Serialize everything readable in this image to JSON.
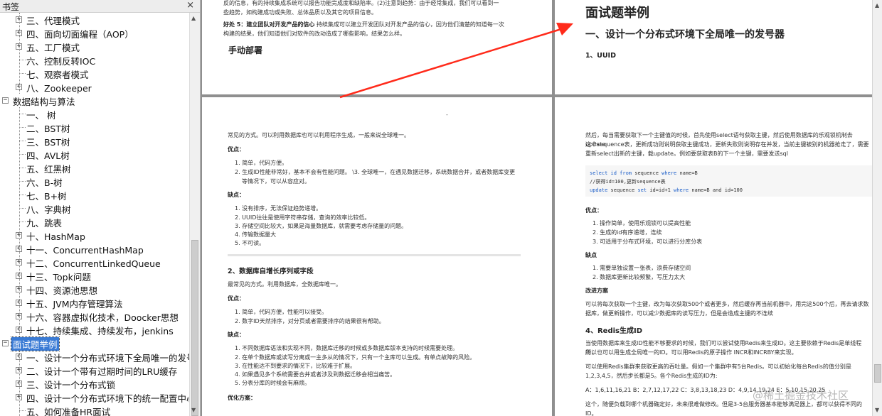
{
  "sidebar": {
    "title": "书签",
    "close": "×",
    "items": [
      {
        "level": 1,
        "expander": "+",
        "label": "三、代理模式"
      },
      {
        "level": 1,
        "expander": "+",
        "label": "四、面向切面编程（AOP）"
      },
      {
        "level": 1,
        "expander": "+",
        "label": "五、工厂模式"
      },
      {
        "level": 1,
        "expander": "",
        "label": "六、控制反转IOC"
      },
      {
        "level": 1,
        "expander": "",
        "label": "七、观察者模式"
      },
      {
        "level": 1,
        "expander": "+",
        "label": "八、Zookeeper"
      },
      {
        "level": 0,
        "expander": "−",
        "label": "数据结构与算法"
      },
      {
        "level": 1,
        "expander": "",
        "label": "一、 树"
      },
      {
        "level": 1,
        "expander": "",
        "label": "二、BST树"
      },
      {
        "level": 1,
        "expander": "",
        "label": "三、BST树"
      },
      {
        "level": 1,
        "expander": "",
        "label": "四、AVL树"
      },
      {
        "level": 1,
        "expander": "",
        "label": "五、红黑树"
      },
      {
        "level": 1,
        "expander": "",
        "label": "六、B-树"
      },
      {
        "level": 1,
        "expander": "",
        "label": "七、B+树"
      },
      {
        "level": 1,
        "expander": "",
        "label": "八、字典树"
      },
      {
        "level": 1,
        "expander": "",
        "label": "九、跳表"
      },
      {
        "level": 1,
        "expander": "+",
        "label": "十、HashMap"
      },
      {
        "level": 1,
        "expander": "+",
        "label": "十一、ConcurrentHashMap"
      },
      {
        "level": 1,
        "expander": "+",
        "label": "十二、ConcurrentLinkedQueue"
      },
      {
        "level": 1,
        "expander": "+",
        "label": "十三、Topk问题"
      },
      {
        "level": 1,
        "expander": "+",
        "label": "十四、资源池思想"
      },
      {
        "level": 1,
        "expander": "+",
        "label": "十五、JVM内存管理算法"
      },
      {
        "level": 1,
        "expander": "+",
        "label": "十六、容器虚拟化技术，Doocker思想"
      },
      {
        "level": 1,
        "expander": "+",
        "label": "十七、持续集成、持续发布，jenkins"
      },
      {
        "level": 0,
        "expander": "−",
        "label": "面试题举例",
        "selected": true
      },
      {
        "level": 1,
        "expander": "+",
        "label": "一、设计一个分布式环境下全局唯一的发号器"
      },
      {
        "level": 1,
        "expander": "+",
        "label": "二、设计一个带有过期时间的LRU缓存"
      },
      {
        "level": 1,
        "expander": "+",
        "label": "三、设计一个分布式锁"
      },
      {
        "level": 1,
        "expander": "+",
        "label": "四、设计一个分布式环境下的统一配置中心"
      },
      {
        "level": 1,
        "expander": "",
        "label": "五、如何准备HR面试"
      }
    ]
  },
  "p1": {
    "line1": "反的信息，有的持续集成系统可以报告功能完成度和缺陷率。(2)注意到趋势：由于经常集成，我们可以看到一",
    "line2": "些趋势，如构建成功或失败、总体品质以及其它的项目信息。",
    "line3_bold": "好处 5：建立团队对开发产品的信心",
    "line3": " 持续集成可以建立开发团队对开发产品的信心，因为他们清楚的知道每一次",
    "line4": "构建的结果，他们知道他们对软件的改动造成了哪些影响，结果怎么样。",
    "heading": "手动部署"
  },
  "p2": {
    "title": "面试题举例",
    "h2": "一、设计一个分布式环境下全局唯一的发号器",
    "h3": "1、UUID"
  },
  "p3": {
    "intro": "常见的方式。可以利用数据库也可以利用程序生成，一般来说全球唯一。",
    "pros": "优点：",
    "pros_items": [
      "1. 简单，代码方便。",
      "2. 生成ID性能非常好，基本不会有性能问题。 \\3. 全球唯一，在遇见数据迁移，系统数据合并，或者数据库变更",
      "等情况下，可以从容应对。"
    ],
    "cons": "缺点：",
    "cons_items": [
      "1. 没有排序，无法保证趋势递增。",
      "2. UUID往往是使用字符串存储，查询的效率比较低。",
      "3. 存储空间比较大，如果是海量数据库，就需要考虑存储量的问题。",
      "4. 传输数据量大",
      "5. 不可读。"
    ],
    "h2": "2、数据库自增长序列或字段",
    "intro2": "最常见的方式。利用数据库，全数据库唯一。",
    "pros2": "优点：",
    "pros2_items": [
      "1. 简单，代码方便，性能可以接受。",
      "2. 数字ID天然排序，对分页或者需要排序的结果很有帮助。"
    ],
    "cons2": "缺点：",
    "cons2_items": [
      "1. 不同数据库语法和实现不同，数据库迁移的时候或多数据库版本支持的时候需要处理。",
      "2. 在单个数据库或读写分离或一主多从的情况下，只有一个主库可以生成。有单点故障的风险。",
      "3. 在性能达不到要求的情况下，比较难于扩展。",
      "4. 如果遇见多个系统需要合并或者涉及到数据迁移会相当痛苦。",
      "5. 分表分库的时候会有麻烦。"
    ],
    "opt": "优化方案："
  },
  "p4": {
    "para1": "然后，每当需要获取下一个主键值的时候，首先使用select语句获取主键，然后使用数据库的乐观锁机制去update",
    "para2": "这个sequence表，更新成功则说明获取主键成功，更新失败则说明存在并发，当前主键被别的机器抢走了，需要",
    "para3": "重新select出新的主键，载update。例如要获取表B的下一个主键，需要发送sql",
    "code1_kw1": "select id from",
    "code1_tbl": " sequence ",
    "code1_kw2": "where",
    "code1_rest": " name=B",
    "code2": "//获得id=100,更新sequence表",
    "code3_kw1": "update",
    "code3_mid": " sequence ",
    "code3_kw2": "set",
    "code3_rest": " id=id+1 ",
    "code3_kw3": "where",
    "code3_end": " name=B and id=100",
    "pros": "优点：",
    "pros_items": [
      "1. 操作简单，使用乐观锁可以提高性能",
      "2. 生成的id有序递增，连续",
      "3. 可适用于分布式环境，可以进行分库分表"
    ],
    "cons": "缺点",
    "cons_items": [
      "1. 需要单独设置一张表，浪费存储空间",
      "2. 数据库更新比较频繁，写压力太大"
    ],
    "improve": "改进方案",
    "improve1": "可以将每次获取一个主键，改为每次获取500个或者更多，然后缓存再当前机器中，用完这500个后，再去请求数",
    "improve2": "据库，做更新操作，可以减少数据库的读写压力，但是会造成主键的不连续",
    "h3": "4、Redis生成ID",
    "r1": "当使用数据库来生成ID性能不够要求的时候，我们可以尝试使用Redis来生成ID。这主要依赖于Redis是单线程的，",
    "r2": "所以也可以用生成全局唯一的ID。可以用Redis的原子操作 INCR和INCRBY来实现。",
    "r3": "可以使用Redis集群来获取更高的吞吐量。假如一个集群中有5台Redis。可以初始化每台Redis的值分别是",
    "r4": "1,2,3,4,5，然后步长都是5。各个Redis生成的ID为:",
    "r5": "A：1,6,11,16,21 B：2,7,12,17,22 C：3,8,13,18,23 D：4,9,14,19,24 E：5,10,15,20,25",
    "r6": "这个，随便负载到哪个机器确定好，未来很难做修改。但是3-5台服务器基本能够满足器上，都可以获得不同的ID。"
  },
  "watermark": "@稀土掘金技术社区",
  "colors": {
    "accent": "#ff2a1a",
    "selection": "#3a7bd5"
  }
}
